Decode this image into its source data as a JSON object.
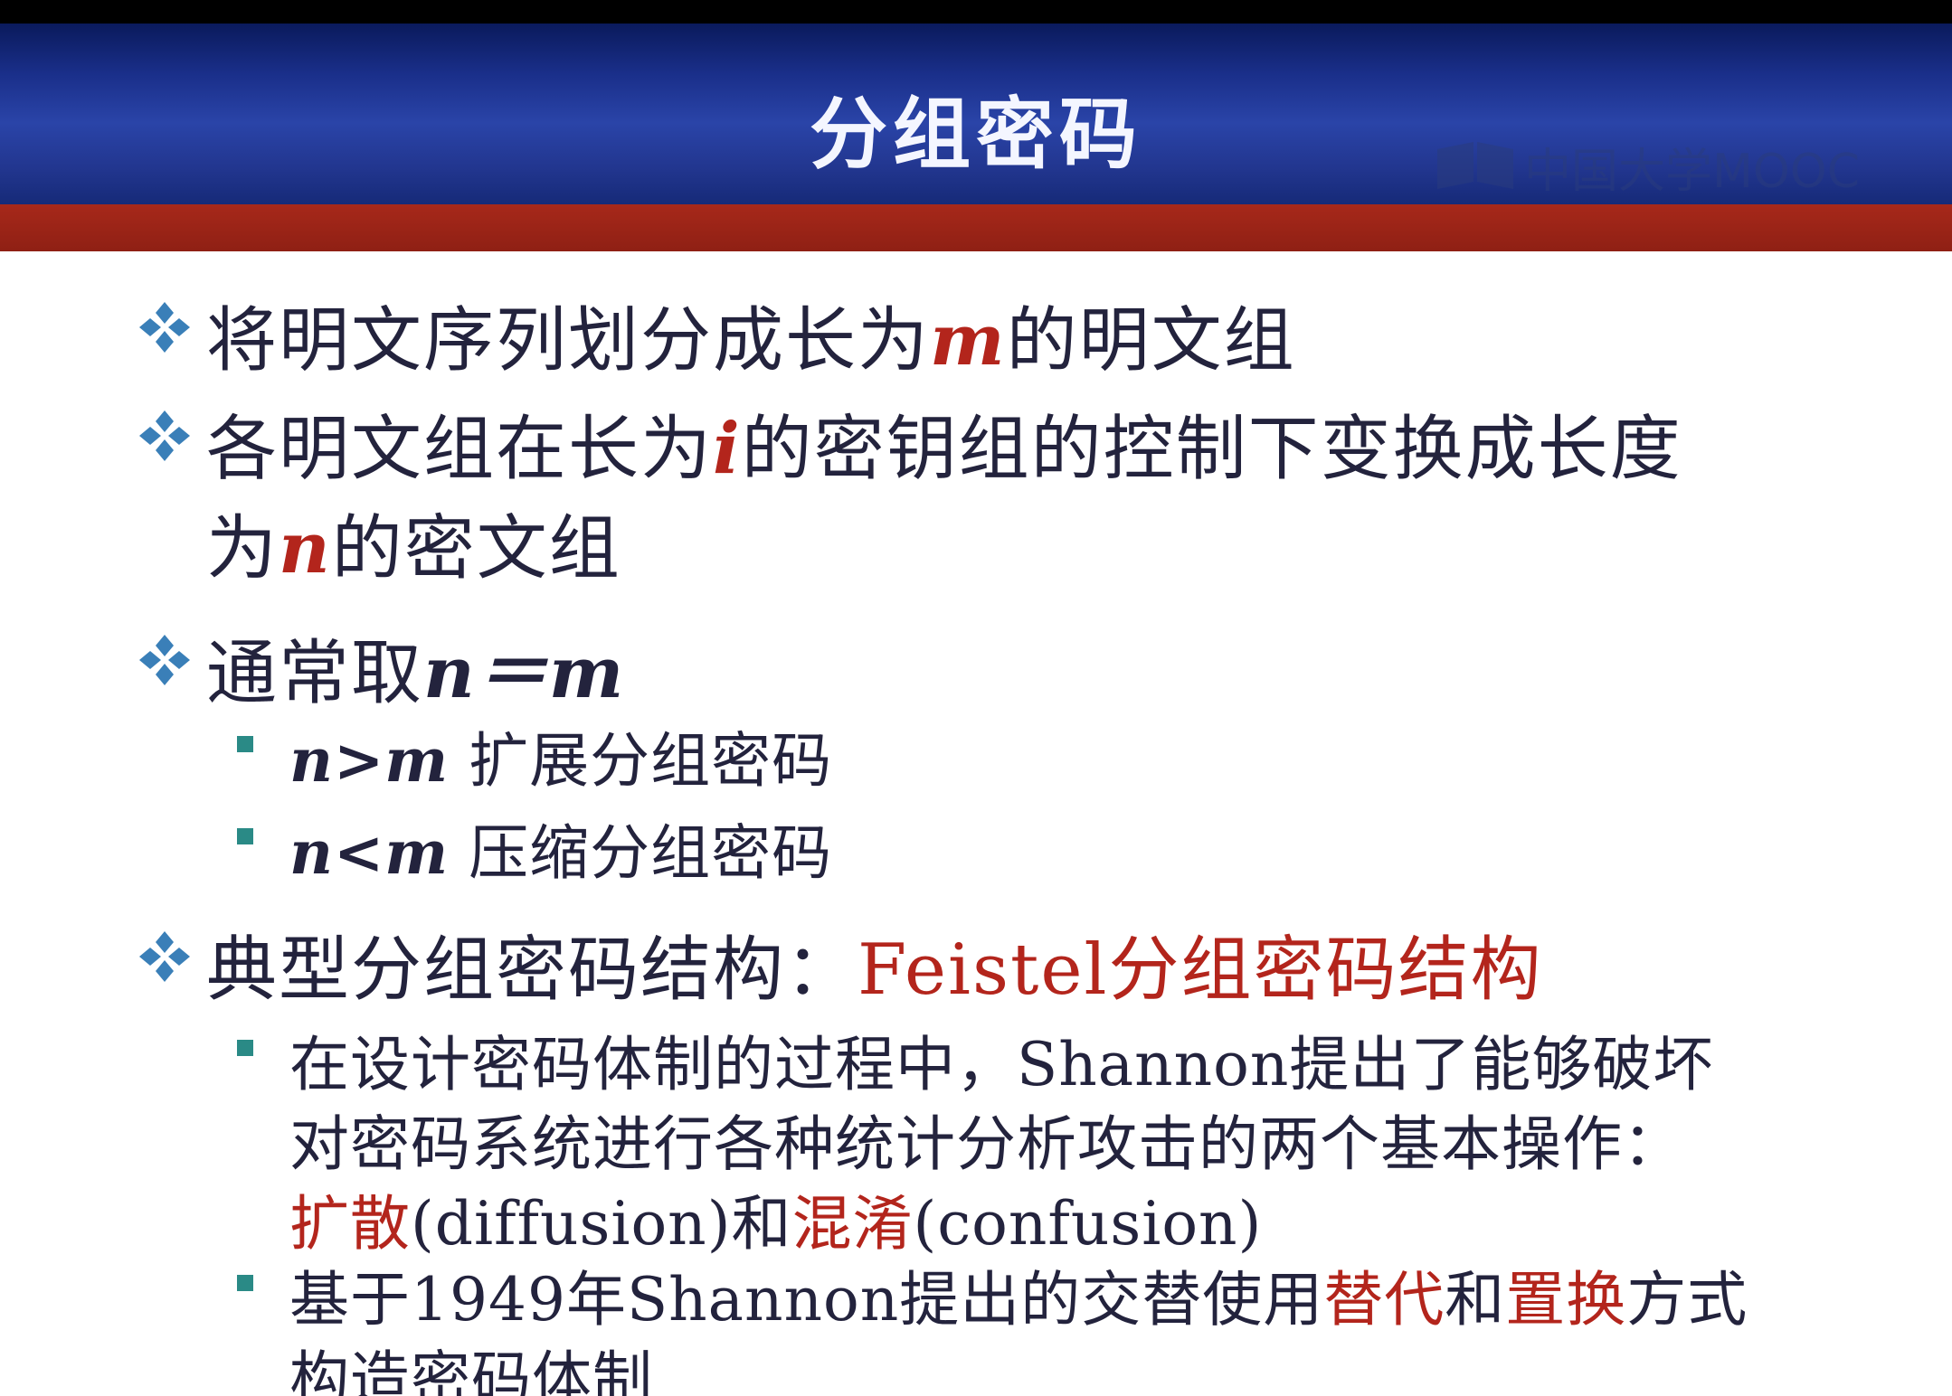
{
  "title": "分组密码",
  "watermark": "中国大学MOOC",
  "bullets": {
    "b1": {
      "pre": "将明文序列划分成长为",
      "var": "m",
      "post": "的明文组"
    },
    "b2": {
      "line1_pre": "各明文组在长为",
      "line1_var": "i",
      "line1_post": "的密钥组的控制下变换成长度",
      "line2_pre": "为",
      "line2_var": "n",
      "line2_post": "的密文组"
    },
    "b3": {
      "text": "通常取",
      "formula": "n＝m"
    },
    "b3_sub1": {
      "formula": "n>m",
      "text": " 扩展分组密码"
    },
    "b3_sub2": {
      "formula": "n<m",
      "text": " 压缩分组密码"
    },
    "b4": {
      "text": "典型分组密码结构：",
      "red": "Feistel分组密码结构"
    },
    "b4_sub1": {
      "line1": "在设计密码体制的过程中，Shannon提出了能够破坏",
      "line2": "对密码系统进行各种统计分析攻击的两个基本操作：",
      "line3_red1": "扩散",
      "line3_mid": "(diffusion)和",
      "line3_red2": "混淆",
      "line3_end": "(confusion)"
    },
    "b4_sub2": {
      "pre": "基于1949年Shannon提出的交替使用",
      "red1": "替代",
      "mid": "和",
      "red2": "置换",
      "post": "方式",
      "line2": "构造密码体制"
    }
  },
  "colors": {
    "accent_red": "#b3251c",
    "header_blue": "#1a2f8a",
    "bullet_teal": "#2a8a86"
  }
}
